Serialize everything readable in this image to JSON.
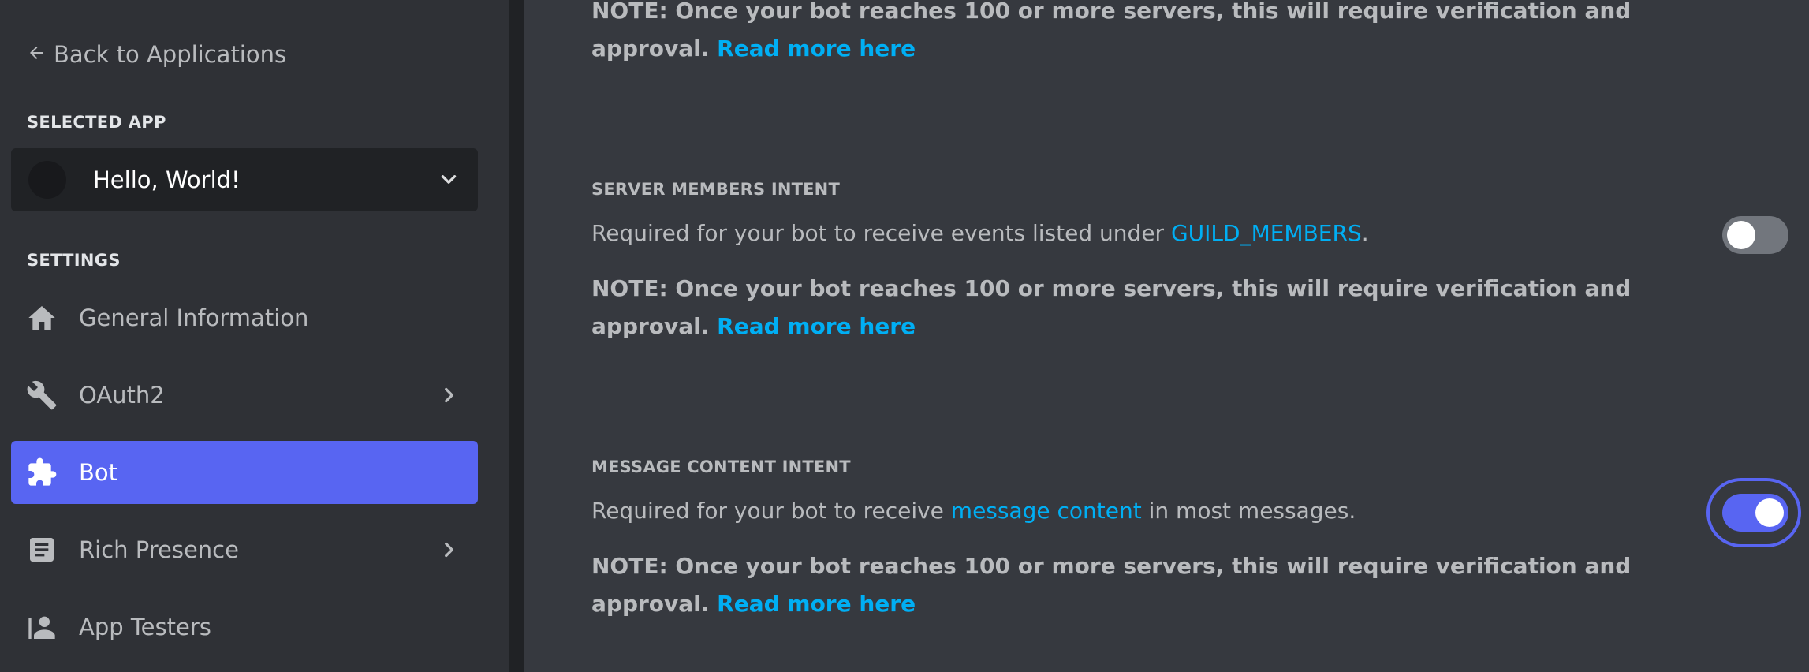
{
  "sidebar": {
    "back_label": "Back to Applications",
    "selected_app_label": "SELECTED APP",
    "app_name": "Hello, World!",
    "settings_label": "SETTINGS",
    "items": [
      {
        "label": "General Information",
        "icon": "home-icon"
      },
      {
        "label": "OAuth2",
        "icon": "wrench-icon"
      },
      {
        "label": "Bot",
        "icon": "puzzle-icon"
      },
      {
        "label": "Rich Presence",
        "icon": "document-icon"
      },
      {
        "label": "App Testers",
        "icon": "person-icon"
      }
    ]
  },
  "intents": {
    "top_note": {
      "text": "NOTE: Once your bot reaches 100 or more servers, this will require verification and approval. ",
      "link": "Read more here"
    },
    "server_members": {
      "title": "SERVER MEMBERS INTENT",
      "desc_pre": "Required for your bot to receive events listed under ",
      "desc_link": "GUILD_MEMBERS",
      "desc_post": ".",
      "note": "NOTE: Once your bot reaches 100 or more servers, this will require verification and approval. ",
      "note_link": "Read more here",
      "enabled": false
    },
    "message_content": {
      "title": "MESSAGE CONTENT INTENT",
      "desc_pre": "Required for your bot to receive ",
      "desc_link": "message content",
      "desc_post": " in most messages.",
      "note": "NOTE: Once your bot reaches 100 or more servers, this will require verification and approval. ",
      "note_link": "Read more here",
      "enabled": true
    }
  },
  "colors": {
    "accent": "#5865f2",
    "link": "#00aff4",
    "sidebar_bg": "#2f3136",
    "main_bg": "#36393f"
  }
}
